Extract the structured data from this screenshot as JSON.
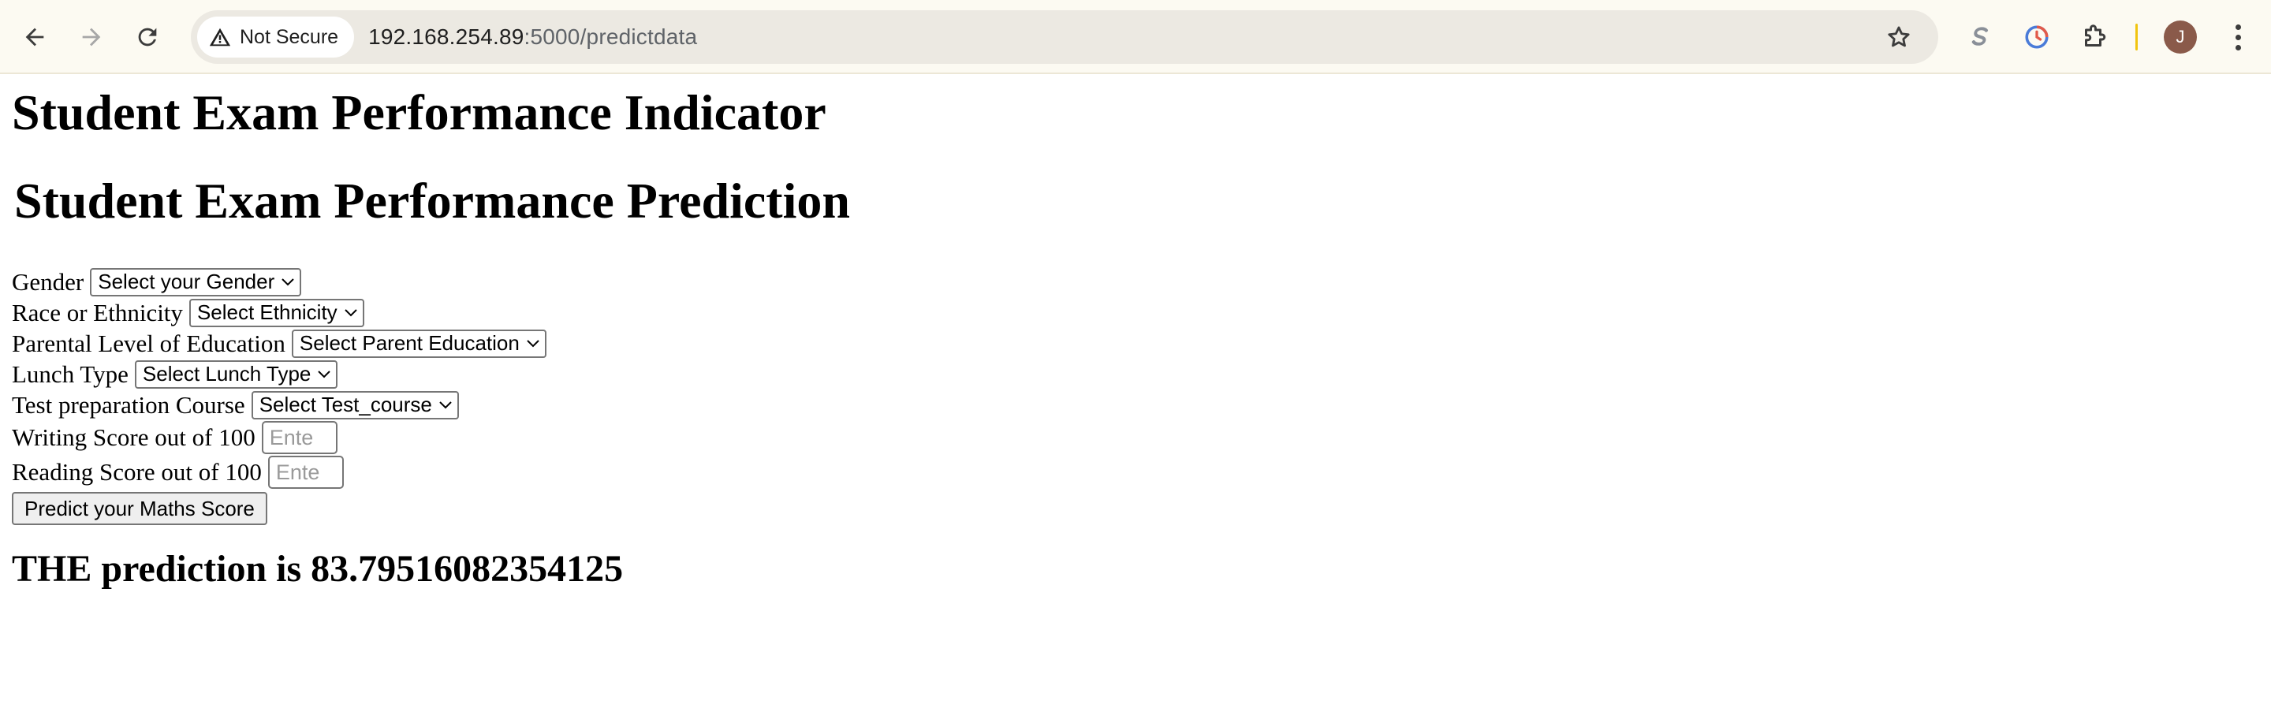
{
  "browser": {
    "security_label": "Not Secure",
    "url_host": "192.168.254.89",
    "url_path": ":5000/predictdata",
    "avatar_initial": "J",
    "icons": [
      "back-icon",
      "forward-icon",
      "reload-icon",
      "warning-icon",
      "star-icon",
      "s-extension-icon",
      "clock-extension-icon",
      "puzzle-icon",
      "avatar",
      "menu-icon"
    ]
  },
  "page": {
    "title": "Student Exam Performance Indicator",
    "subtitle": "Student Exam Performance Prediction",
    "form": {
      "gender": {
        "label": "Gender",
        "selected": "Select your Gender"
      },
      "ethnicity": {
        "label": "Race or Ethnicity",
        "selected": "Select Ethnicity"
      },
      "parental_education": {
        "label": "Parental Level of Education",
        "selected": "Select Parent Education"
      },
      "lunch": {
        "label": "Lunch Type",
        "selected": "Select Lunch Type"
      },
      "test_prep": {
        "label": "Test preparation Course",
        "selected": "Select Test_course"
      },
      "writing": {
        "label": "Writing Score out of 100",
        "placeholder": "Ente"
      },
      "reading": {
        "label": "Reading Score out of 100",
        "placeholder": "Ente"
      },
      "submit_label": "Predict your Maths Score"
    },
    "result": "THE prediction is 83.79516082354125"
  }
}
